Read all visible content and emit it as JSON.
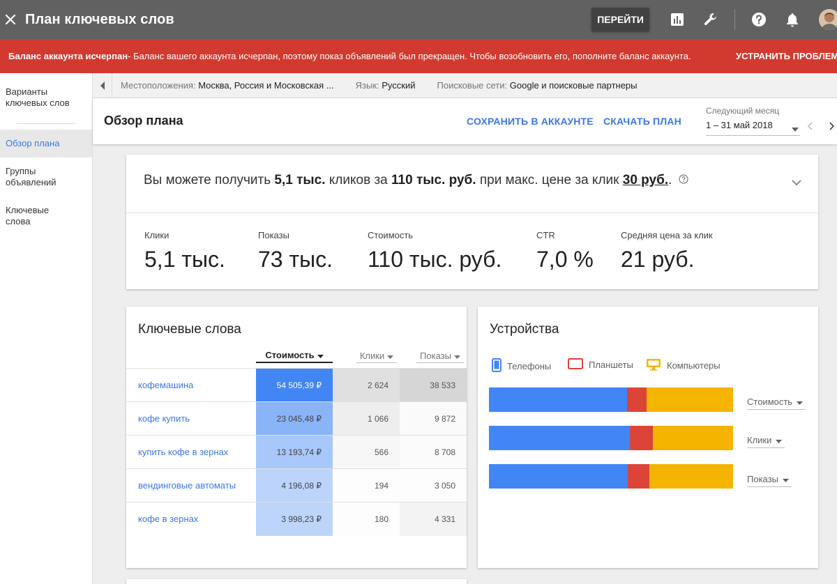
{
  "header": {
    "title": "План ключевых слов",
    "go_label": "ПЕРЕЙТИ"
  },
  "alert": {
    "bold": "Баланс аккаунта исчерпан",
    "text": " - Баланс вашего аккаунта исчерпан, поэтому показ объявлений был прекращен. Чтобы возобновить его, пополните баланс аккаунта.",
    "action": "УСТРАНИТЬ ПРОБЛЕМУ"
  },
  "nav": {
    "items": [
      {
        "label_1": "Варианты",
        "label_2": "ключевых слов"
      },
      {
        "label_1": "Обзор плана"
      },
      {
        "label_1": "Группы",
        "label_2": "объявлений"
      },
      {
        "label_1": "Ключевые",
        "label_2": "слова"
      }
    ]
  },
  "filters": {
    "location_label": "Местоположения:",
    "location_value": "Москва, Россия и Московская ...",
    "language_label": "Язык:",
    "language_value": "Русский",
    "network_label": "Поисковые сети:",
    "network_value": "Google и поисковые партнеры"
  },
  "plan": {
    "title": "Обзор плана",
    "save_label": "СОХРАНИТЬ В АККАУНТЕ",
    "download_label": "СКАЧАТЬ ПЛАН",
    "period_label": "Следующий месяц",
    "period_value": "1 – 31 май 2018"
  },
  "summary": {
    "s1": "Вы можете получить ",
    "clicks": "5,1 тыс.",
    "s2": " кликов за ",
    "cost": "110 тыс. руб.",
    "s3": " при макс. цене за клик ",
    "max_cpc": "30 руб.",
    "s4": ".",
    "metrics": [
      {
        "label": "Клики",
        "value": "5,1 тыс."
      },
      {
        "label": "Показы",
        "value": "73 тыс."
      },
      {
        "label": "Стоимость",
        "value": "110 тыс. руб."
      },
      {
        "label": "CTR",
        "value": "7,0 %"
      },
      {
        "label": "Средняя цена за клик",
        "value": "21 руб."
      }
    ]
  },
  "keywords": {
    "title": "Ключевые слова",
    "columns": {
      "cost": "Стоимость",
      "clicks": "Клики",
      "shows": "Показы"
    },
    "rows": [
      {
        "name": "кофемашина",
        "cost": "54 505,39 ₽",
        "clicks": "2 624",
        "shows": "38 533"
      },
      {
        "name": "кофе купить",
        "cost": "23 045,48 ₽",
        "clicks": "1 066",
        "shows": "9 872"
      },
      {
        "name": "купить кофе в зернах",
        "cost": "13 193,74 ₽",
        "clicks": "566",
        "shows": "8 708"
      },
      {
        "name": "вендинговые автоматы",
        "cost": "4 196,08 ₽",
        "clicks": "194",
        "shows": "3 050"
      },
      {
        "name": "кофе в зернах",
        "cost": "3 998,23 ₽",
        "clicks": "180",
        "shows": "4 331"
      }
    ]
  },
  "devices": {
    "title": "Устройства",
    "legend": {
      "phones": "Телефоны",
      "tablets": "Планшеты",
      "computers": "Компьютеры"
    },
    "colors": {
      "phones": "#4285f4",
      "tablets": "#db4437",
      "computers": "#f4b400"
    },
    "bars": [
      {
        "label": "Стоимость",
        "phones": 0.566,
        "tablets": 0.08,
        "computers": 0.354
      },
      {
        "label": "Клики",
        "phones": 0.577,
        "tablets": 0.094,
        "computers": 0.329
      },
      {
        "label": "Показы",
        "phones": 0.569,
        "tablets": 0.089,
        "computers": 0.342
      }
    ]
  }
}
